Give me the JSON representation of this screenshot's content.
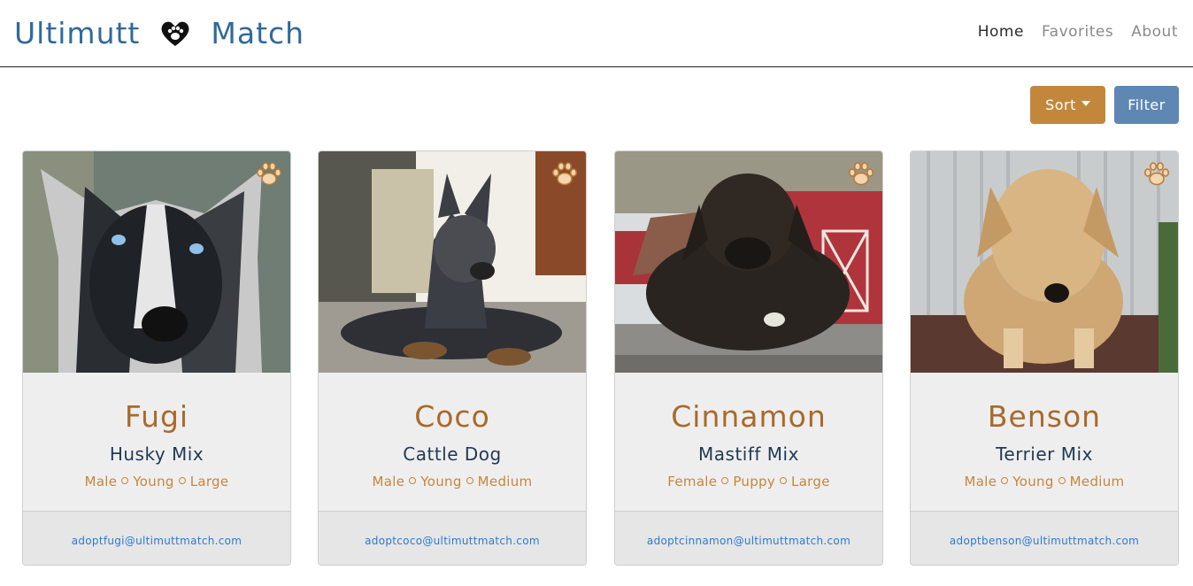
{
  "brand": {
    "left": "Ultimutt",
    "right": "Match",
    "icon": "heart-paw-icon",
    "color": "#2f6a9c"
  },
  "nav": {
    "items": [
      {
        "label": "Home",
        "active": true
      },
      {
        "label": "Favorites",
        "active": false
      },
      {
        "label": "About",
        "active": false
      }
    ]
  },
  "toolbar": {
    "sort_label": "Sort",
    "filter_label": "Filter"
  },
  "colors": {
    "accent": "#c3873c",
    "filter": "#5e87b3",
    "link": "#2a7ad8"
  },
  "dogs": [
    {
      "name": "Fugi",
      "breed": "Husky Mix",
      "gender": "Male",
      "age": "Young",
      "size": "Large",
      "email": "adoptfugi@ultimuttmatch.com"
    },
    {
      "name": "Coco",
      "breed": "Cattle Dog",
      "gender": "Male",
      "age": "Young",
      "size": "Medium",
      "email": "adoptcoco@ultimuttmatch.com"
    },
    {
      "name": "Cinnamon",
      "breed": "Mastiff Mix",
      "gender": "Female",
      "age": "Puppy",
      "size": "Large",
      "email": "adoptcinnamon@ultimuttmatch.com"
    },
    {
      "name": "Benson",
      "breed": "Terrier Mix",
      "gender": "Male",
      "age": "Young",
      "size": "Medium",
      "email": "adoptbenson@ultimuttmatch.com"
    }
  ]
}
